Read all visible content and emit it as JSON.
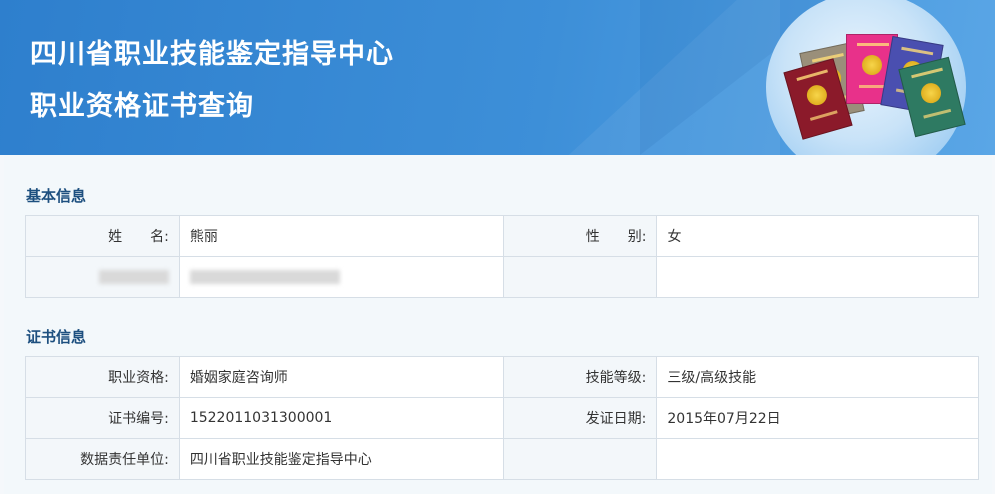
{
  "header": {
    "title_line1": "四川省职业技能鉴定指导中心",
    "title_line2": "职业资格证书查询"
  },
  "basic_info": {
    "section_title": "基本信息",
    "rows": [
      {
        "label1": "姓　　名:",
        "value1": "熊丽",
        "label2": "性　　别:",
        "value2": "女"
      }
    ]
  },
  "certificate_info": {
    "section_title": "证书信息",
    "rows": [
      {
        "label1": "职业资格:",
        "value1": "婚姻家庭咨询师",
        "label2": "技能等级:",
        "value2": "三级/高级技能"
      },
      {
        "label1": "证书编号:",
        "value1": "1522011031300001",
        "label2": "发证日期:",
        "value2": "2015年07月22日"
      },
      {
        "label1": "数据责任单位:",
        "value1": "四川省职业技能鉴定指导中心",
        "label2": "",
        "value2": ""
      }
    ]
  },
  "colors": {
    "header_blue": "#2e7fcd",
    "section_title": "#1d4f7f",
    "label_bg": "#f3f7fa",
    "border": "#d6dee6"
  },
  "icons": [
    "certificate-books-illustration"
  ]
}
